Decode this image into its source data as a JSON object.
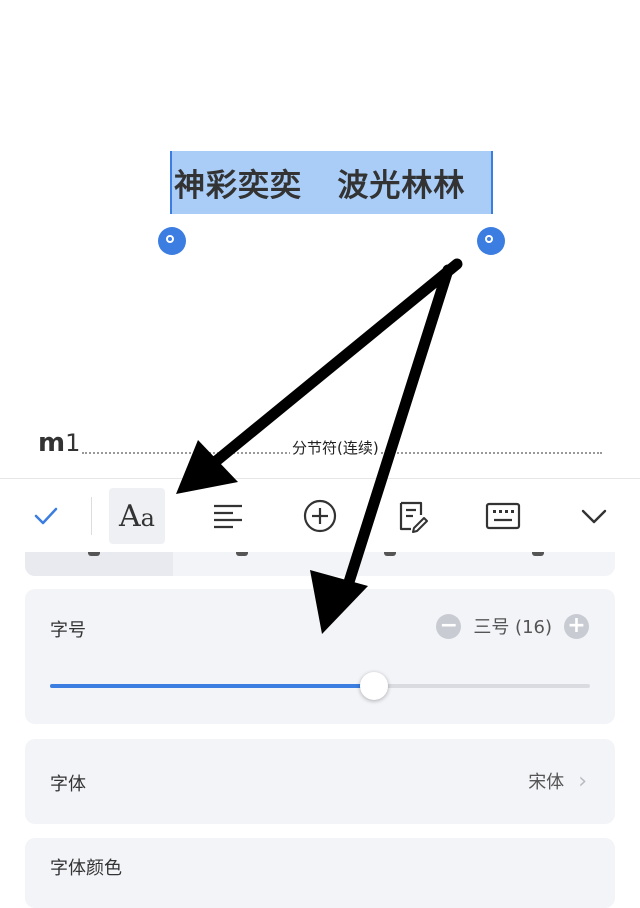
{
  "document": {
    "selected_text": "神彩奕奕   波光林林",
    "heading_prefix": "m",
    "heading_number": "1",
    "section_break_label": "分节符(连续)"
  },
  "toolbar": {
    "items": [
      {
        "name": "confirm-check",
        "icon": "check-icon"
      },
      {
        "name": "font-format",
        "icon": "font-aa-icon",
        "label": "Aa",
        "active": true
      },
      {
        "name": "paragraph",
        "icon": "align-left-icon"
      },
      {
        "name": "insert",
        "icon": "plus-circle-icon"
      },
      {
        "name": "edit-notes",
        "icon": "note-edit-icon"
      },
      {
        "name": "keyboard",
        "icon": "keyboard-icon"
      },
      {
        "name": "collapse",
        "icon": "chevron-down-icon"
      }
    ]
  },
  "font_panel": {
    "size": {
      "label": "字号",
      "value_text": "三号 (16)",
      "slider_fraction": 0.6
    },
    "font": {
      "label": "字体",
      "value": "宋体"
    },
    "color": {
      "label": "字体颜色"
    }
  },
  "colors": {
    "accent": "#3b7de0",
    "selection": "#a9cdf7",
    "card_bg": "#f3f4f8"
  }
}
